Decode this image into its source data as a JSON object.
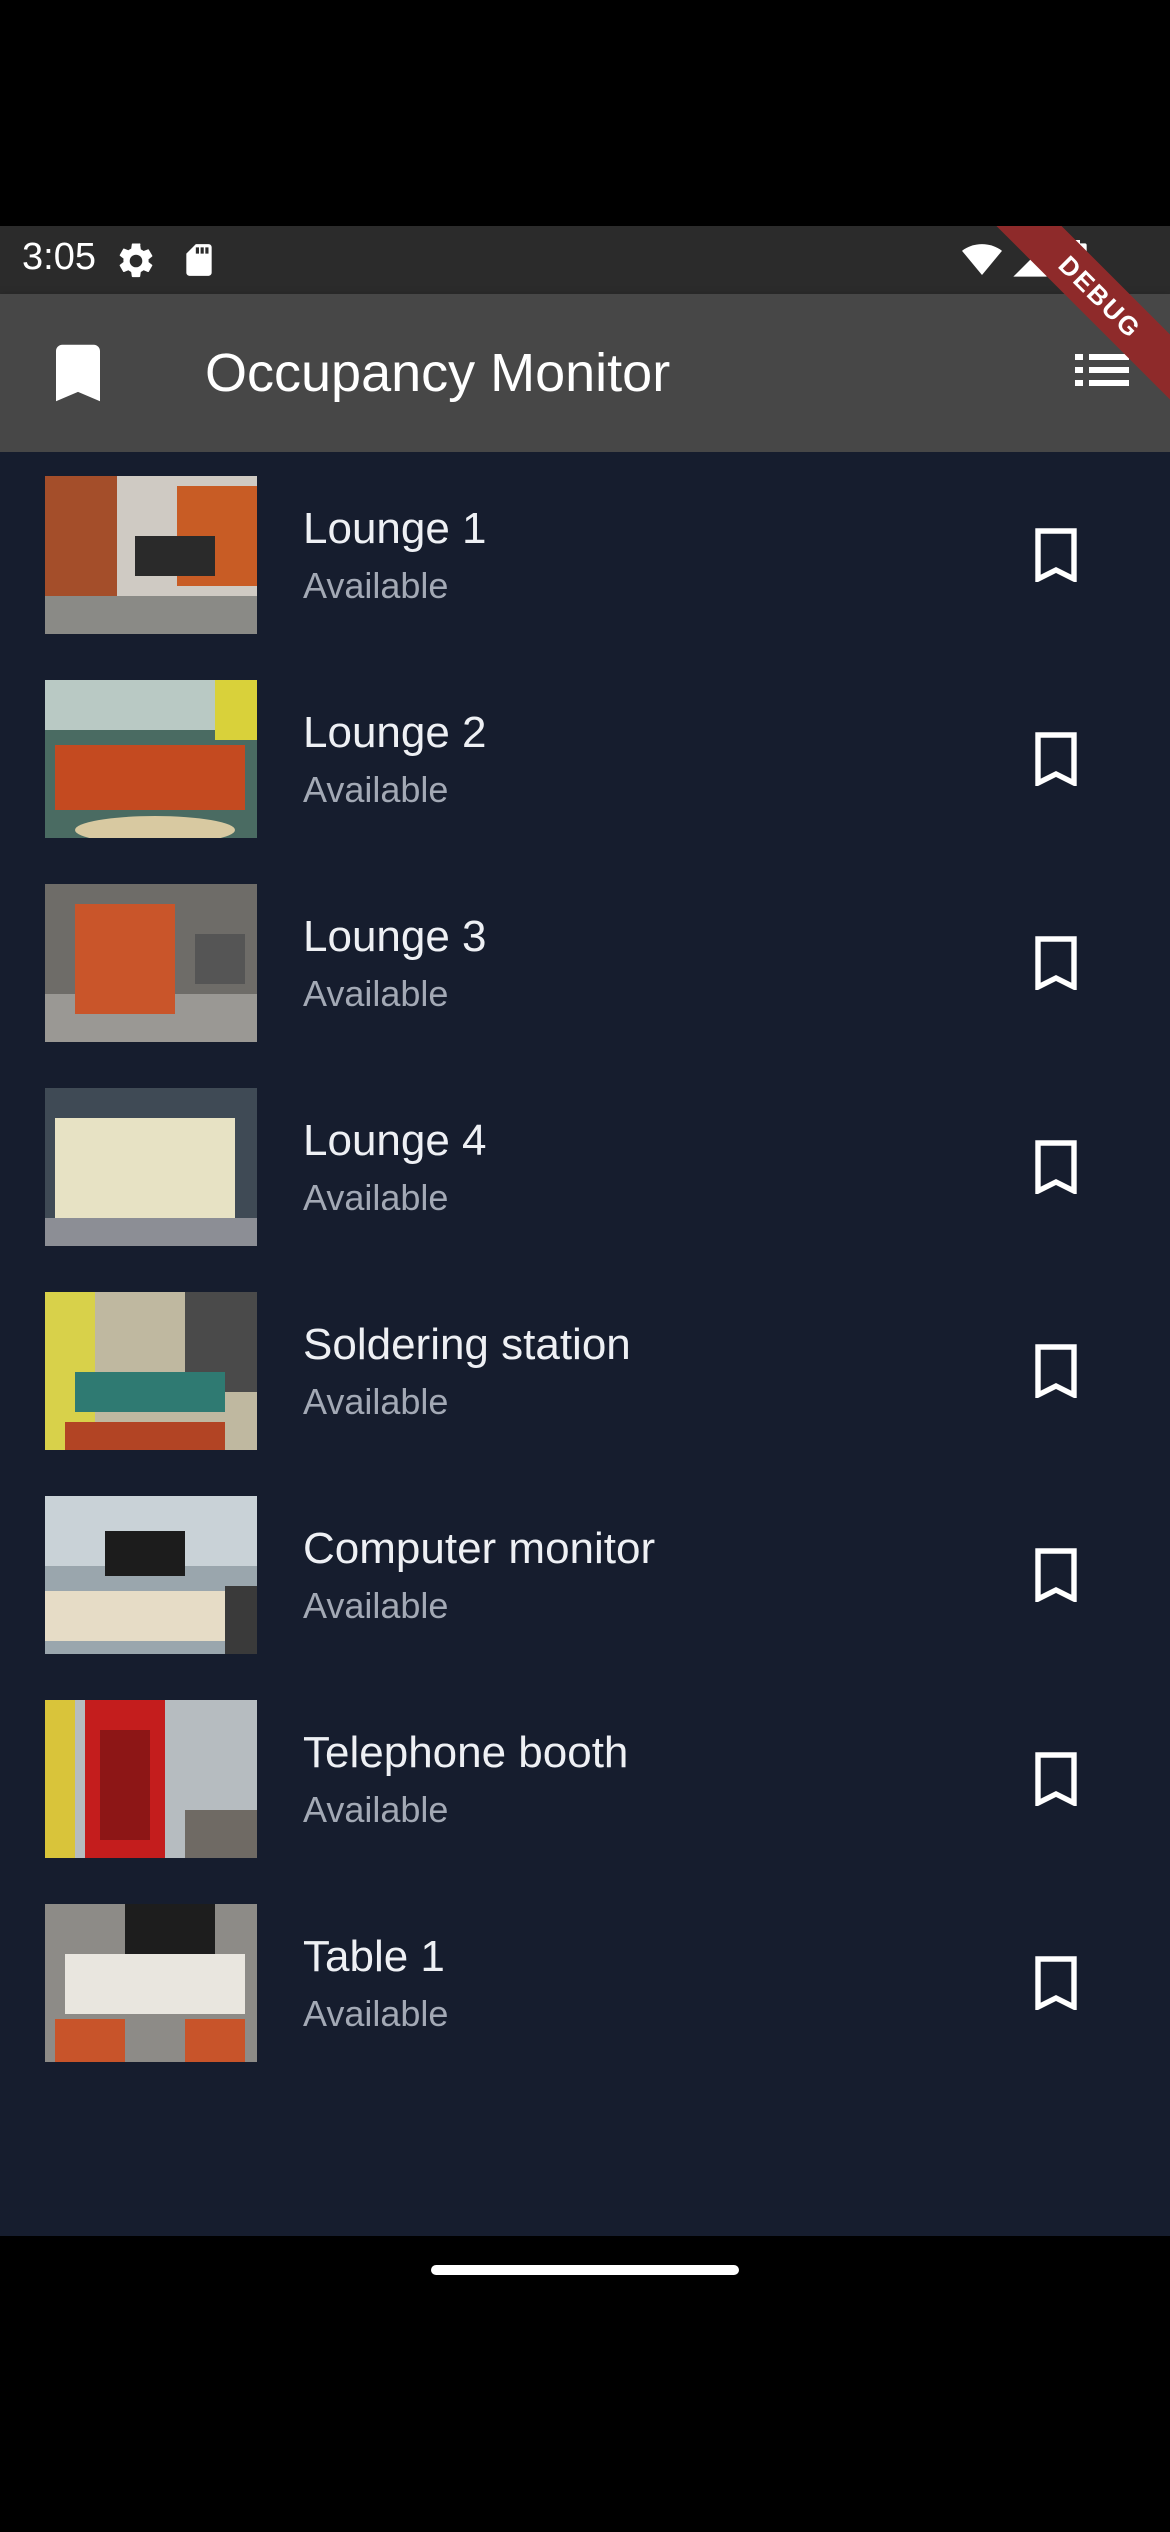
{
  "status": {
    "time": "3:05"
  },
  "appbar": {
    "title": "Occupancy Monitor"
  },
  "debug_banner": "DEBUG",
  "items": [
    {
      "title": "Lounge 1",
      "status": "Available"
    },
    {
      "title": "Lounge 2",
      "status": "Available"
    },
    {
      "title": "Lounge 3",
      "status": "Available"
    },
    {
      "title": "Lounge 4",
      "status": "Available"
    },
    {
      "title": "Soldering station",
      "status": "Available"
    },
    {
      "title": "Computer monitor",
      "status": "Available"
    },
    {
      "title": "Telephone booth",
      "status": "Available"
    },
    {
      "title": "Table 1",
      "status": "Available"
    }
  ],
  "colors": {
    "background": "#161d2e",
    "appbar": "#474747",
    "statusbar": "#2b2b2b",
    "subtitle": "#a3a9b5",
    "debug": "#8e2a2a"
  },
  "icons": [
    "settings-icon",
    "sd-card-icon",
    "wifi-icon",
    "signal-icon",
    "battery-icon",
    "bookmark-icon",
    "list-icon",
    "bookmark-outline-icon"
  ]
}
